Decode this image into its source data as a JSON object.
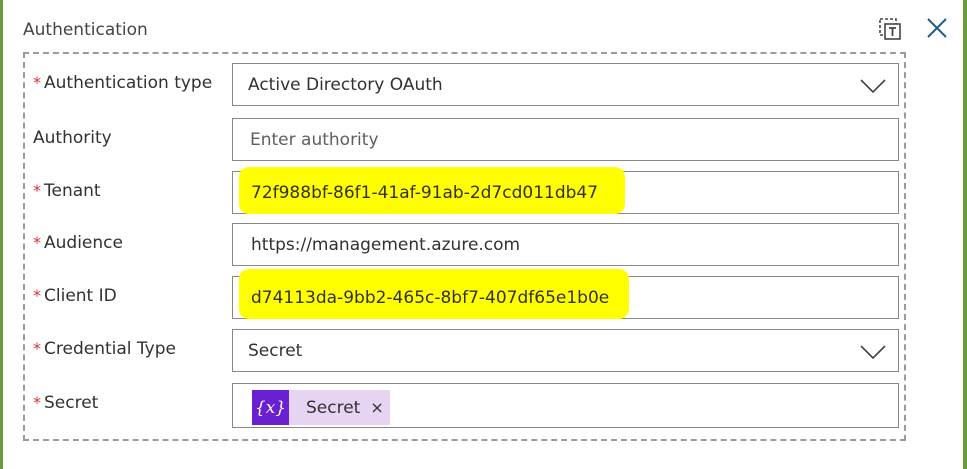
{
  "header": {
    "title": "Authentication",
    "icons": [
      "copy-to-clipboard-icon",
      "close-icon"
    ]
  },
  "colors": {
    "required_marker": "#d13438",
    "highlight": "#ffff00",
    "token_icon_bg": "#6a1fd0",
    "token_bg": "#e6d4f3",
    "frame": "#6a9a3a"
  },
  "fields": {
    "auth_type": {
      "required": "*",
      "label": "Authentication type",
      "value": "Active Directory OAuth"
    },
    "authority": {
      "label": "Authority",
      "placeholder": "Enter authority"
    },
    "tenant": {
      "required": "*",
      "label": "Tenant",
      "value": "72f988bf-86f1-41af-91ab-2d7cd011db47"
    },
    "audience": {
      "required": "*",
      "label": "Audience",
      "value": "https://management.azure.com"
    },
    "client_id": {
      "required": "*",
      "label": "Client ID",
      "value": "d74113da-9bb2-465c-8bf7-407df65e1b0e"
    },
    "credential_type": {
      "required": "*",
      "label": "Credential Type",
      "value": "Secret"
    },
    "secret": {
      "required": "*",
      "label": "Secret",
      "token": {
        "icon": "{x}",
        "label": "Secret",
        "remove": "×"
      }
    }
  }
}
